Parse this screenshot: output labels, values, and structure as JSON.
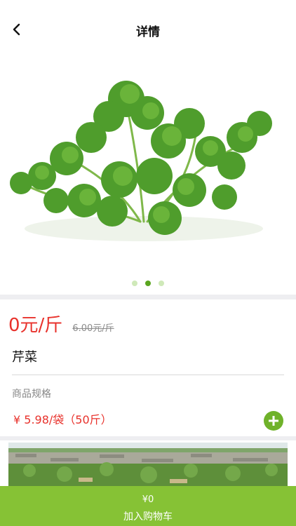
{
  "header": {
    "title": "详情",
    "back_icon": "chevron-left-icon"
  },
  "carousel": {
    "slide_count": 3,
    "active_index": 1,
    "image": "cilantro-bunch-photo"
  },
  "product": {
    "price": "0元/斤",
    "original_price": "6.00元/斤",
    "name": "芹菜",
    "spec_label": "商品规格",
    "spec_value": "¥ 5.98/袋（50斤）",
    "add_icon": "plus-circle-icon"
  },
  "detail_image": "field-wall-photo",
  "cart": {
    "total": "¥0",
    "label": "加入购物车"
  },
  "colors": {
    "accent": "#86c235",
    "price": "#e8322c",
    "add_button": "#6fb22a"
  }
}
